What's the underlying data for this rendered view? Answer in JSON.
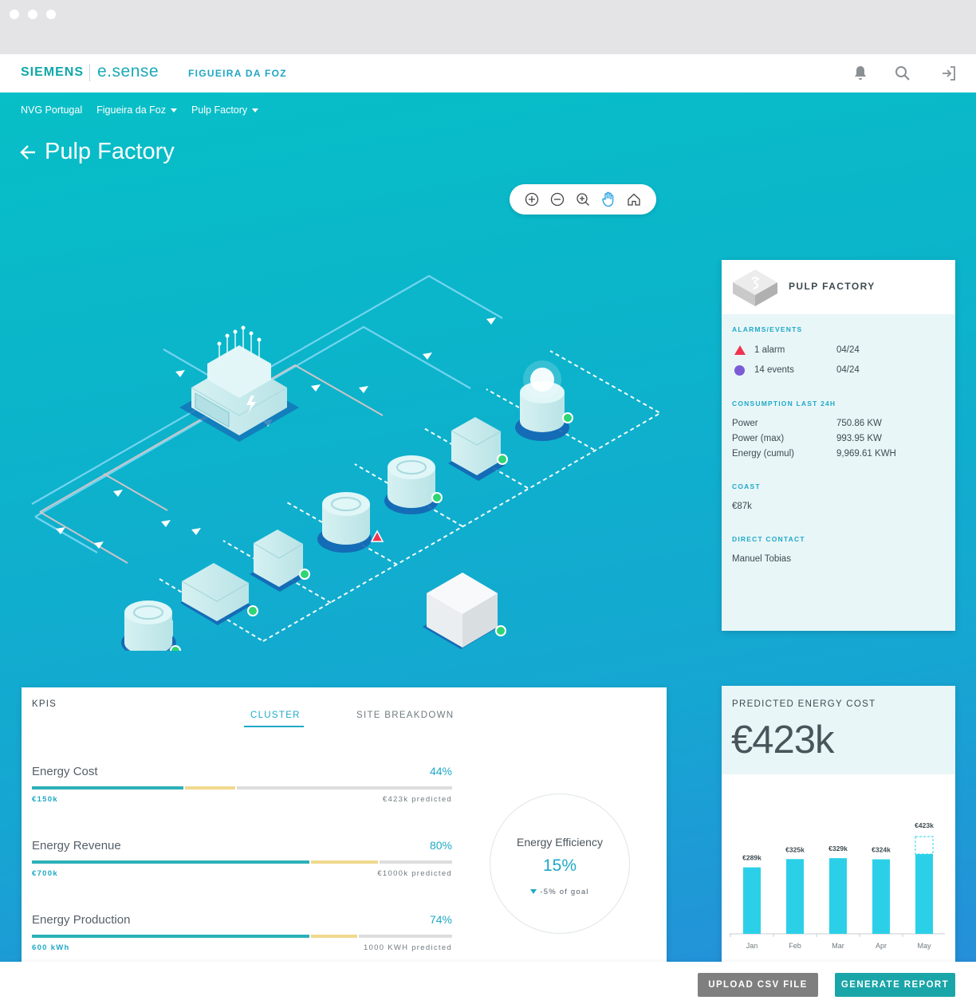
{
  "header": {
    "brand": "SIEMENS",
    "product": "e.sense",
    "site": "FIGUEIRA DA FOZ",
    "icons": [
      "bell-icon",
      "search-icon",
      "logout-icon"
    ]
  },
  "breadcrumbs": [
    {
      "label": "NVG Portugal",
      "dropdown": false
    },
    {
      "label": "Figueira da Foz",
      "dropdown": true
    },
    {
      "label": "Pulp Factory",
      "dropdown": true
    }
  ],
  "page": {
    "title": "Pulp Factory"
  },
  "map_toolbar": [
    "zoom-in-icon",
    "zoom-out-icon",
    "zoom-search-icon",
    "hand-icon",
    "home-icon"
  ],
  "info_panel": {
    "title": "PULP FACTORY",
    "alarms_label": "ALARMS/EVENTS",
    "alarm": {
      "text": "1 alarm",
      "date": "04/24",
      "color": "#f0344f"
    },
    "events": {
      "text": "14 events",
      "date": "04/24",
      "color": "#7b5cd6"
    },
    "consumption_label": "CONSUMPTION LAST 24H",
    "consumption": [
      {
        "key": "Power",
        "value": "750.86 KW"
      },
      {
        "key": "Power (max)",
        "value": "993.95 KW"
      },
      {
        "key": "Energy (cumul)",
        "value": "9,969.61 KWH"
      }
    ],
    "coast_label": "COAST",
    "coast_value": "€87k",
    "contact_label": "DIRECT CONTACT",
    "contact_value": "Manuel Tobias"
  },
  "kpis": {
    "label": "KPIS",
    "tabs": [
      {
        "label": "CLUSTER",
        "active": true
      },
      {
        "label": "SITE BREAKDOWN",
        "active": false
      }
    ],
    "rows": [
      {
        "name": "Energy Cost",
        "pct": "44%",
        "left": "€150k",
        "right": "€423k predicted",
        "main": 0.36,
        "mid": 0.12
      },
      {
        "name": "Energy Revenue",
        "pct": "80%",
        "left": "€700k",
        "right": "€1000k predicted",
        "main": 0.66,
        "mid": 0.16
      },
      {
        "name": "Energy Production",
        "pct": "74%",
        "left": "600 kWh",
        "right": "1000 KWH predicted",
        "main": 0.66,
        "mid": 0.11
      }
    ],
    "efficiency": {
      "title": "Energy Efficiency",
      "value": "15%",
      "goal": "-5% of goal"
    }
  },
  "predicted": {
    "label": "PREDICTED ENERGY COST",
    "value": "€423k"
  },
  "chart_data": {
    "type": "bar",
    "categories": [
      "Jan",
      "Feb",
      "Mar",
      "Apr",
      "May"
    ],
    "values": [
      289,
      325,
      329,
      324,
      423
    ],
    "value_labels": [
      "€289k",
      "€325k",
      "€329k",
      "€324k",
      "€423k"
    ],
    "predicted_last": true,
    "color": "#2bd0e8"
  },
  "footer": {
    "upload_label": "UPLOAD CSV FILE",
    "report_label": "GENERATE REPORT"
  }
}
